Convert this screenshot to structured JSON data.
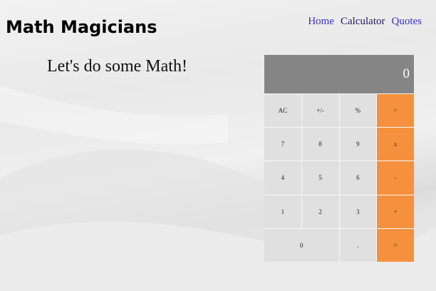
{
  "header": {
    "title": "Math Magicians",
    "nav": [
      "Home",
      "Calculator",
      "Quotes"
    ]
  },
  "main": {
    "intro": "Let's do some Math!"
  },
  "calculator": {
    "display": "0",
    "keys": {
      "ac": "AC",
      "plus_minus": "+/-",
      "percent": "%",
      "divide": "÷",
      "seven": "7",
      "eight": "8",
      "nine": "9",
      "multiply": "x",
      "four": "4",
      "five": "5",
      "six": "6",
      "minus": "-",
      "one": "1",
      "two": "2",
      "three": "3",
      "plus": "+",
      "zero": "0",
      "dot": ".",
      "equals": "="
    }
  },
  "colors": {
    "operator": "#f5913e",
    "key": "#e0e0e0",
    "display": "#858585",
    "link": "#3c2fc9"
  }
}
